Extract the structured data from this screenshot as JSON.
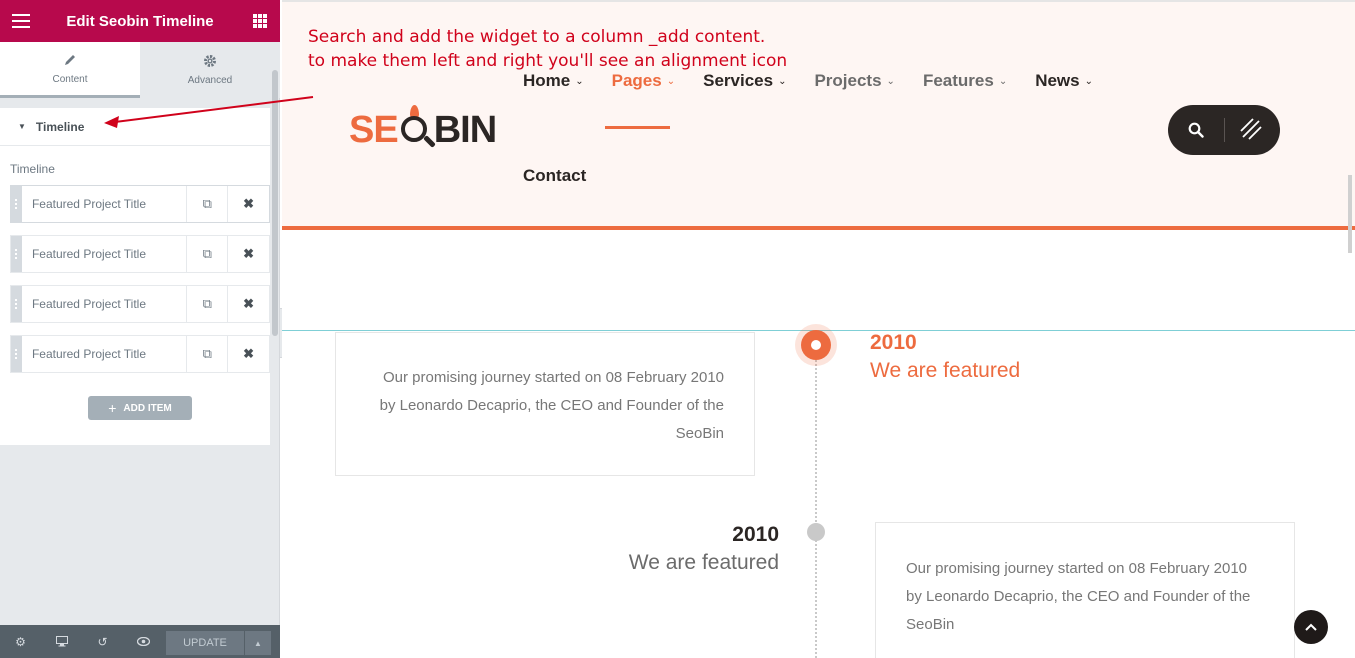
{
  "panel": {
    "header_title": "Edit Seobin Timeline",
    "tabs": [
      {
        "label": "Content",
        "icon": "pencil-icon"
      },
      {
        "label": "Advanced",
        "icon": "gear-icon"
      }
    ],
    "section_title": "Timeline",
    "control_label": "Timeline",
    "items": [
      {
        "title": "Featured Project Title"
      },
      {
        "title": "Featured Project Title"
      },
      {
        "title": "Featured Project Title"
      },
      {
        "title": "Featured Project Title"
      }
    ],
    "add_item_label": "ADD ITEM",
    "footer": {
      "update_label": "UPDATE",
      "icons": [
        "gear-icon",
        "monitor-icon",
        "history-icon",
        "eye-icon"
      ]
    }
  },
  "annotation": {
    "line1": "Search and add the widget to a column _add content.",
    "line2": "to make them left and right you'll see an alignment icon",
    "color": "#d0021b"
  },
  "site": {
    "logo_part1": "SE",
    "logo_part2": "BIN",
    "nav": [
      {
        "label": "Home",
        "has_dropdown": true
      },
      {
        "label": "Pages",
        "has_dropdown": true
      },
      {
        "label": "Services",
        "has_dropdown": true
      },
      {
        "label": "Projects",
        "has_dropdown": true
      },
      {
        "label": "Features",
        "has_dropdown": true
      },
      {
        "label": "News",
        "has_dropdown": true
      }
    ],
    "nav_contact": "Contact",
    "accent_color": "#ed6b3f",
    "dark_color": "#2b2624"
  },
  "timeline": [
    {
      "year": "2010",
      "heading": "We are featured",
      "text": "Our promising journey started on 08 February 2010 by Leonardo Decaprio, the CEO and Founder of the SeoBin"
    },
    {
      "year": "2010",
      "heading": "We are featured",
      "text": "Our promising journey started on 08 February 2010 by Leonardo Decaprio, the CEO and Founder of the SeoBin"
    }
  ]
}
